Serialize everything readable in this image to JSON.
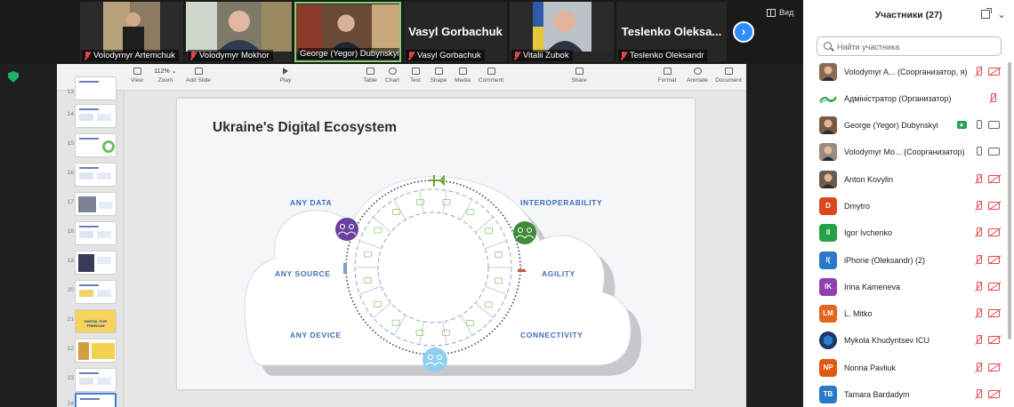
{
  "video_strip": {
    "tiles": [
      {
        "name": "Volodymyr Artemchuk"
      },
      {
        "name": "Volodymyr Mokhor"
      },
      {
        "name": "George (Yegor) Dubynskyi"
      },
      {
        "name": "Vasyl Gorbachuk",
        "big_label": "Vasyl Gorbachuk"
      },
      {
        "name": "Vitalii Zubok"
      },
      {
        "name": "Teslenko Oleksandr",
        "big_label": "Teslenko Oleksa..."
      }
    ],
    "next_icon": "chevron-right-icon",
    "view_label": "Вид"
  },
  "keynote": {
    "toolbar": {
      "view": "View",
      "zoom_value": "112% ⌄",
      "zoom": "Zoom",
      "add_slide": "Add Slide",
      "play": "Play",
      "table": "Table",
      "chart": "Chart",
      "text": "Text",
      "shape": "Shape",
      "media": "Media",
      "comment": "Comment",
      "share": "Share",
      "format": "Format",
      "animate": "Animate",
      "document": "Document"
    },
    "slide_numbers": [
      "13",
      "14",
      "15",
      "16",
      "17",
      "18",
      "19",
      "20",
      "21",
      "22",
      "23",
      "24"
    ],
    "slide21_text": "DIGITAL FOR FREEDOM",
    "slide": {
      "title": "Ukraine's Digital Ecosystem",
      "labels": {
        "any_data": "ANY DATA",
        "interoperability": "INTEROPERABILITY",
        "any_source": "ANY SOURCE",
        "agility": "AGILITY",
        "any_device": "ANY DEVICE",
        "connectivity": "CONNECTIVITY"
      }
    }
  },
  "participants": {
    "title": "Участники (27)",
    "search_placeholder": "Найти участника",
    "list": [
      {
        "name": "Volodymyr A... (Соорганизатор, я)",
        "initials": "",
        "color": "#8a6a50",
        "avatar": "photo"
      },
      {
        "name": "Адміністратор (Организатор)",
        "initials": "",
        "color": "#ffffff",
        "avatar": "logo"
      },
      {
        "name": "George (Yegor) Dubynskyi",
        "initials": "",
        "color": "#7a5a45",
        "avatar": "photo"
      },
      {
        "name": "Volodymyr Mo... (Соорганизатор)",
        "initials": "",
        "color": "#9a8a80",
        "avatar": "photo"
      },
      {
        "name": "Anton Kovylin",
        "initials": "",
        "color": "#6b5a4e",
        "avatar": "photo"
      },
      {
        "name": "Dmytro",
        "initials": "D",
        "color": "#d9481c"
      },
      {
        "name": "Igor Ivchenko",
        "initials": "II",
        "color": "#25a244"
      },
      {
        "name": "iPhone (Oleksandr) (2)",
        "initials": "I(",
        "color": "#2a78c8"
      },
      {
        "name": "Irina Kameneva",
        "initials": "IK",
        "color": "#8e3fb0"
      },
      {
        "name": "L. Mitko",
        "initials": "LM",
        "color": "#e2661d"
      },
      {
        "name": "Mykola Khudyntsev ICU",
        "initials": "",
        "color": "#1b3a6b",
        "avatar": "logo2"
      },
      {
        "name": "Nonna Pavliuk",
        "initials": "NP",
        "color": "#e05a14"
      },
      {
        "name": "Tamara Bardadym",
        "initials": "TB",
        "color": "#2a78c8"
      }
    ]
  }
}
